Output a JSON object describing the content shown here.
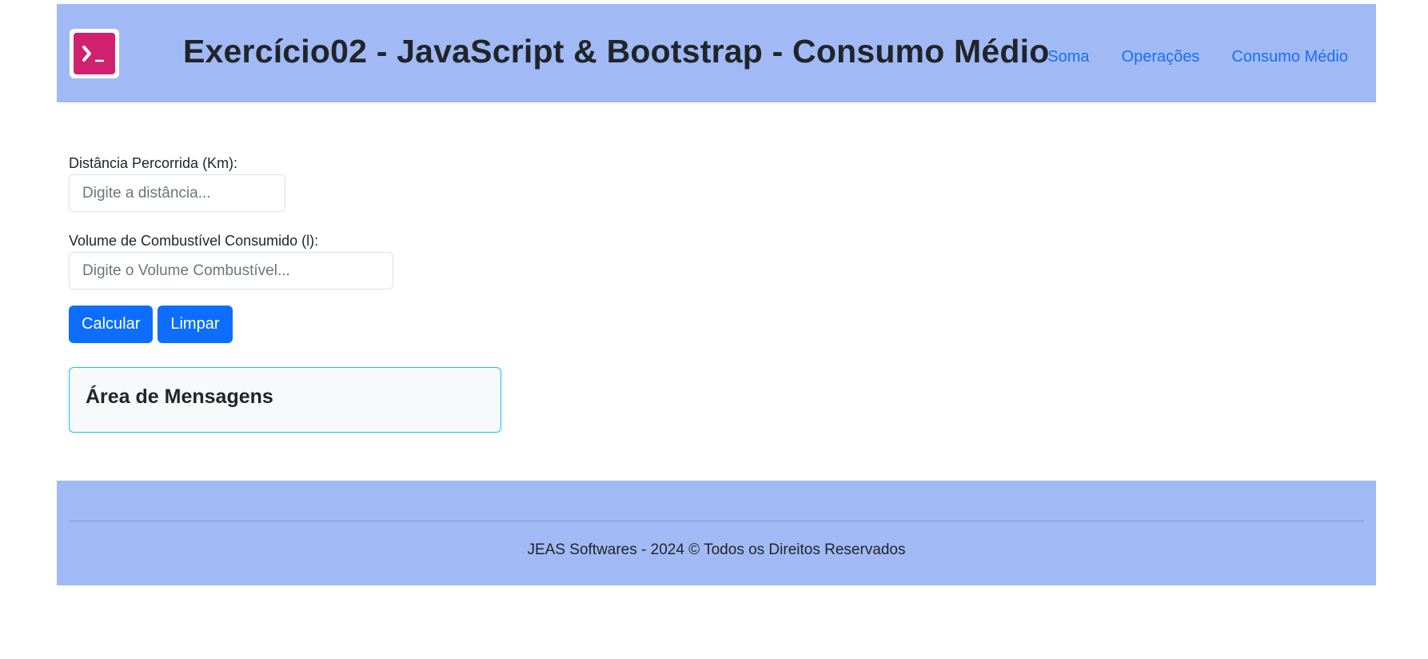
{
  "header": {
    "title": "Exercício02 - JavaScript & Bootstrap - Consumo Médio",
    "logo_icon": "terminal-icon",
    "nav": [
      {
        "label": "Soma"
      },
      {
        "label": "Operações"
      },
      {
        "label": "Consumo Médio"
      }
    ]
  },
  "form": {
    "distance": {
      "label": "Distância Percorrida (Km):",
      "placeholder": "Digite a distância...",
      "value": ""
    },
    "fuel": {
      "label": "Volume de Combustível Consumido (l):",
      "placeholder": "Digite o Volume Combustível...",
      "value": ""
    },
    "buttons": {
      "calculate": "Calcular",
      "clear": "Limpar"
    }
  },
  "messages": {
    "title": "Área de Mensagens"
  },
  "footer": {
    "text": "JEAS Softwares - 2024 © Todos os Direitos Reservados"
  },
  "colors": {
    "header_bg": "#a1baf5",
    "logo_bg": "#d0206e",
    "link": "#1c6ef0",
    "primary": "#0d6efd",
    "info_border": "#0dcaf0"
  }
}
